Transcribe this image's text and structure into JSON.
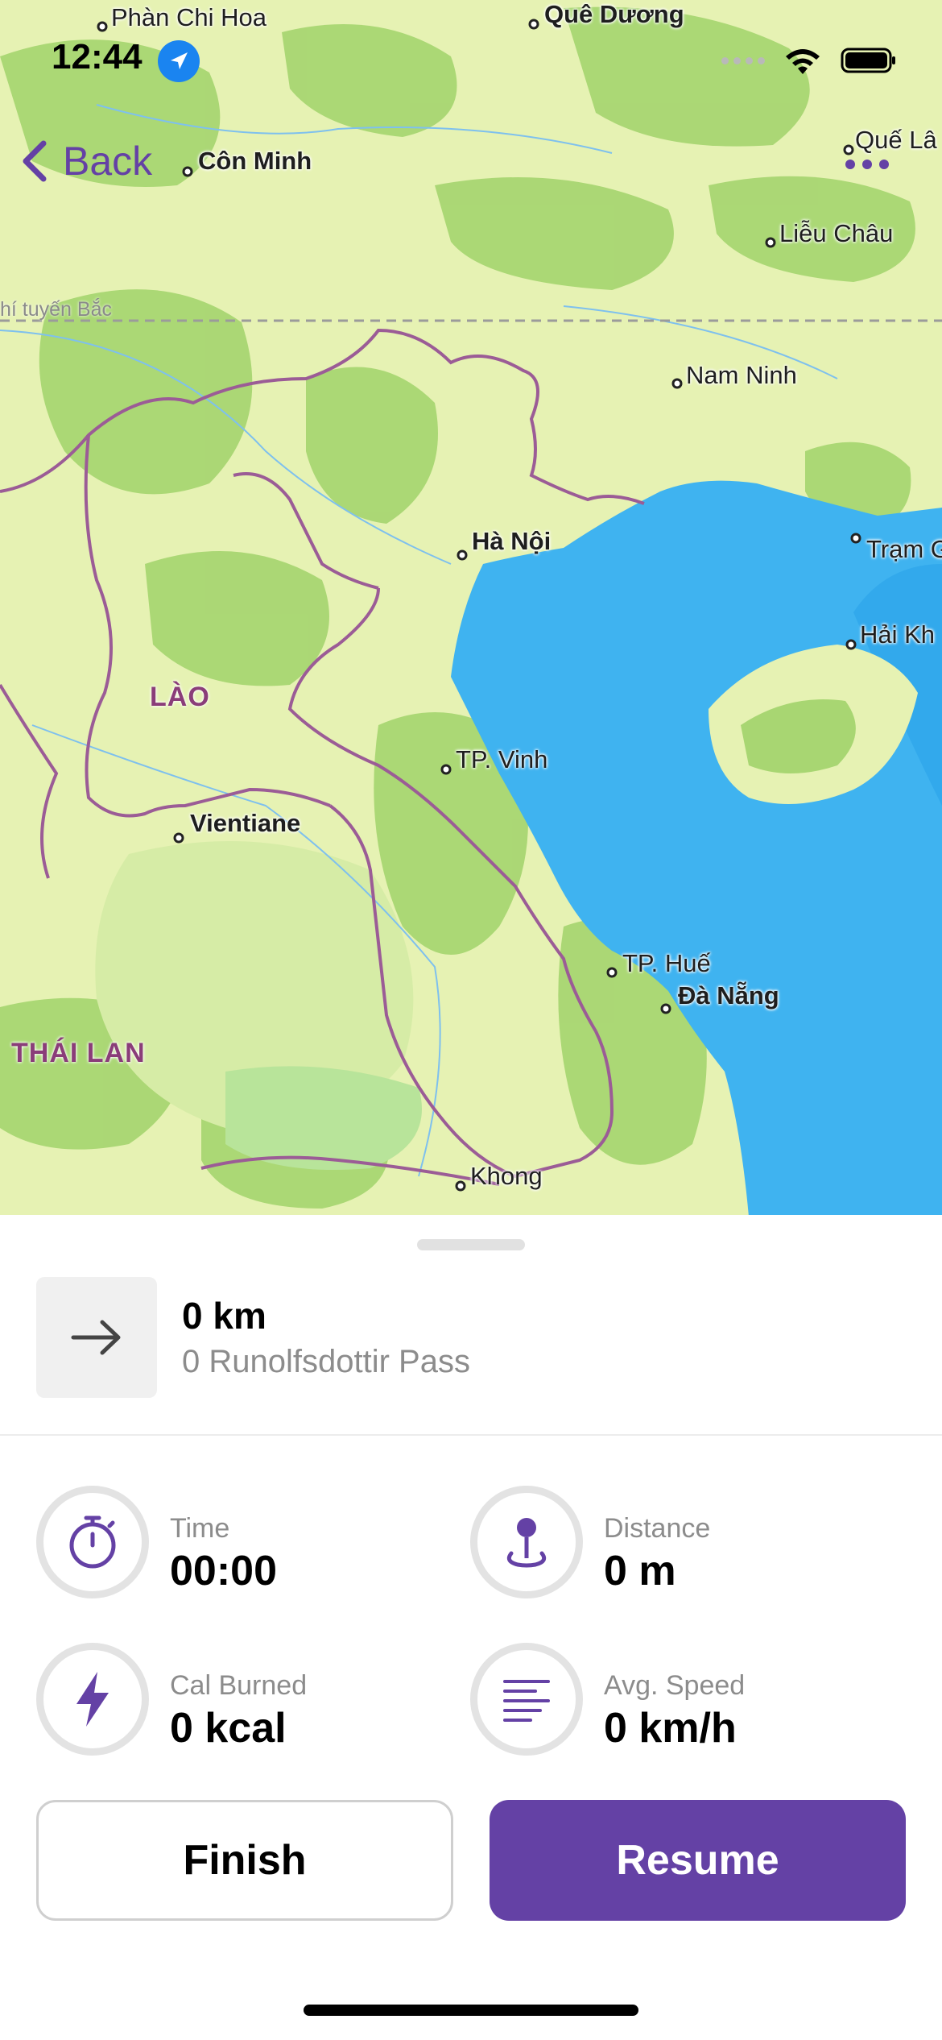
{
  "status_bar": {
    "time": "12:44",
    "icons": [
      "location-arrow-icon",
      "signal-dots-icon",
      "wifi-icon",
      "battery-icon"
    ]
  },
  "nav": {
    "back_label": "Back",
    "back_icon": "chevron-left-icon",
    "more_icon": "more-dots-icon"
  },
  "map": {
    "cities": [
      {
        "name": "Phàn Chi Hoa"
      },
      {
        "name": "Quê Dương"
      },
      {
        "name": "Côn Minh"
      },
      {
        "name": "Quế Lâ"
      },
      {
        "name": "Liễu Châu"
      },
      {
        "name": "Nam Ninh"
      },
      {
        "name": "Hà Nội"
      },
      {
        "name": "Trạm G"
      },
      {
        "name": "Hải Kh"
      },
      {
        "name": "TP. Vinh"
      },
      {
        "name": "Vientiane"
      },
      {
        "name": "TP. Huế"
      },
      {
        "name": "Đà Nẵng"
      },
      {
        "name": "Khong"
      }
    ],
    "countries": [
      "LÀO",
      "THÁI LAN"
    ],
    "tropic_label": "hí tuyến Bắc",
    "colors": {
      "water": "#3fb3f0",
      "land_light": "#eaf4b4",
      "forest": "#a9d86f",
      "border": "#9b5c96"
    }
  },
  "sheet": {
    "route": {
      "icon": "arrow-right-icon",
      "distance": "0 km",
      "name": "0 Runolfsdottir Pass"
    },
    "stats": [
      {
        "icon": "stopwatch-icon",
        "label": "Time",
        "value": "00:00"
      },
      {
        "icon": "location-pin-icon",
        "label": "Distance",
        "value": "0 m"
      },
      {
        "icon": "lightning-icon",
        "label": "Cal Burned",
        "value": "0 kcal"
      },
      {
        "icon": "speed-lines-icon",
        "label": "Avg. Speed",
        "value": "0 km/h"
      }
    ],
    "finish_label": "Finish",
    "resume_label": "Resume",
    "accent_color": "#6441a5"
  }
}
